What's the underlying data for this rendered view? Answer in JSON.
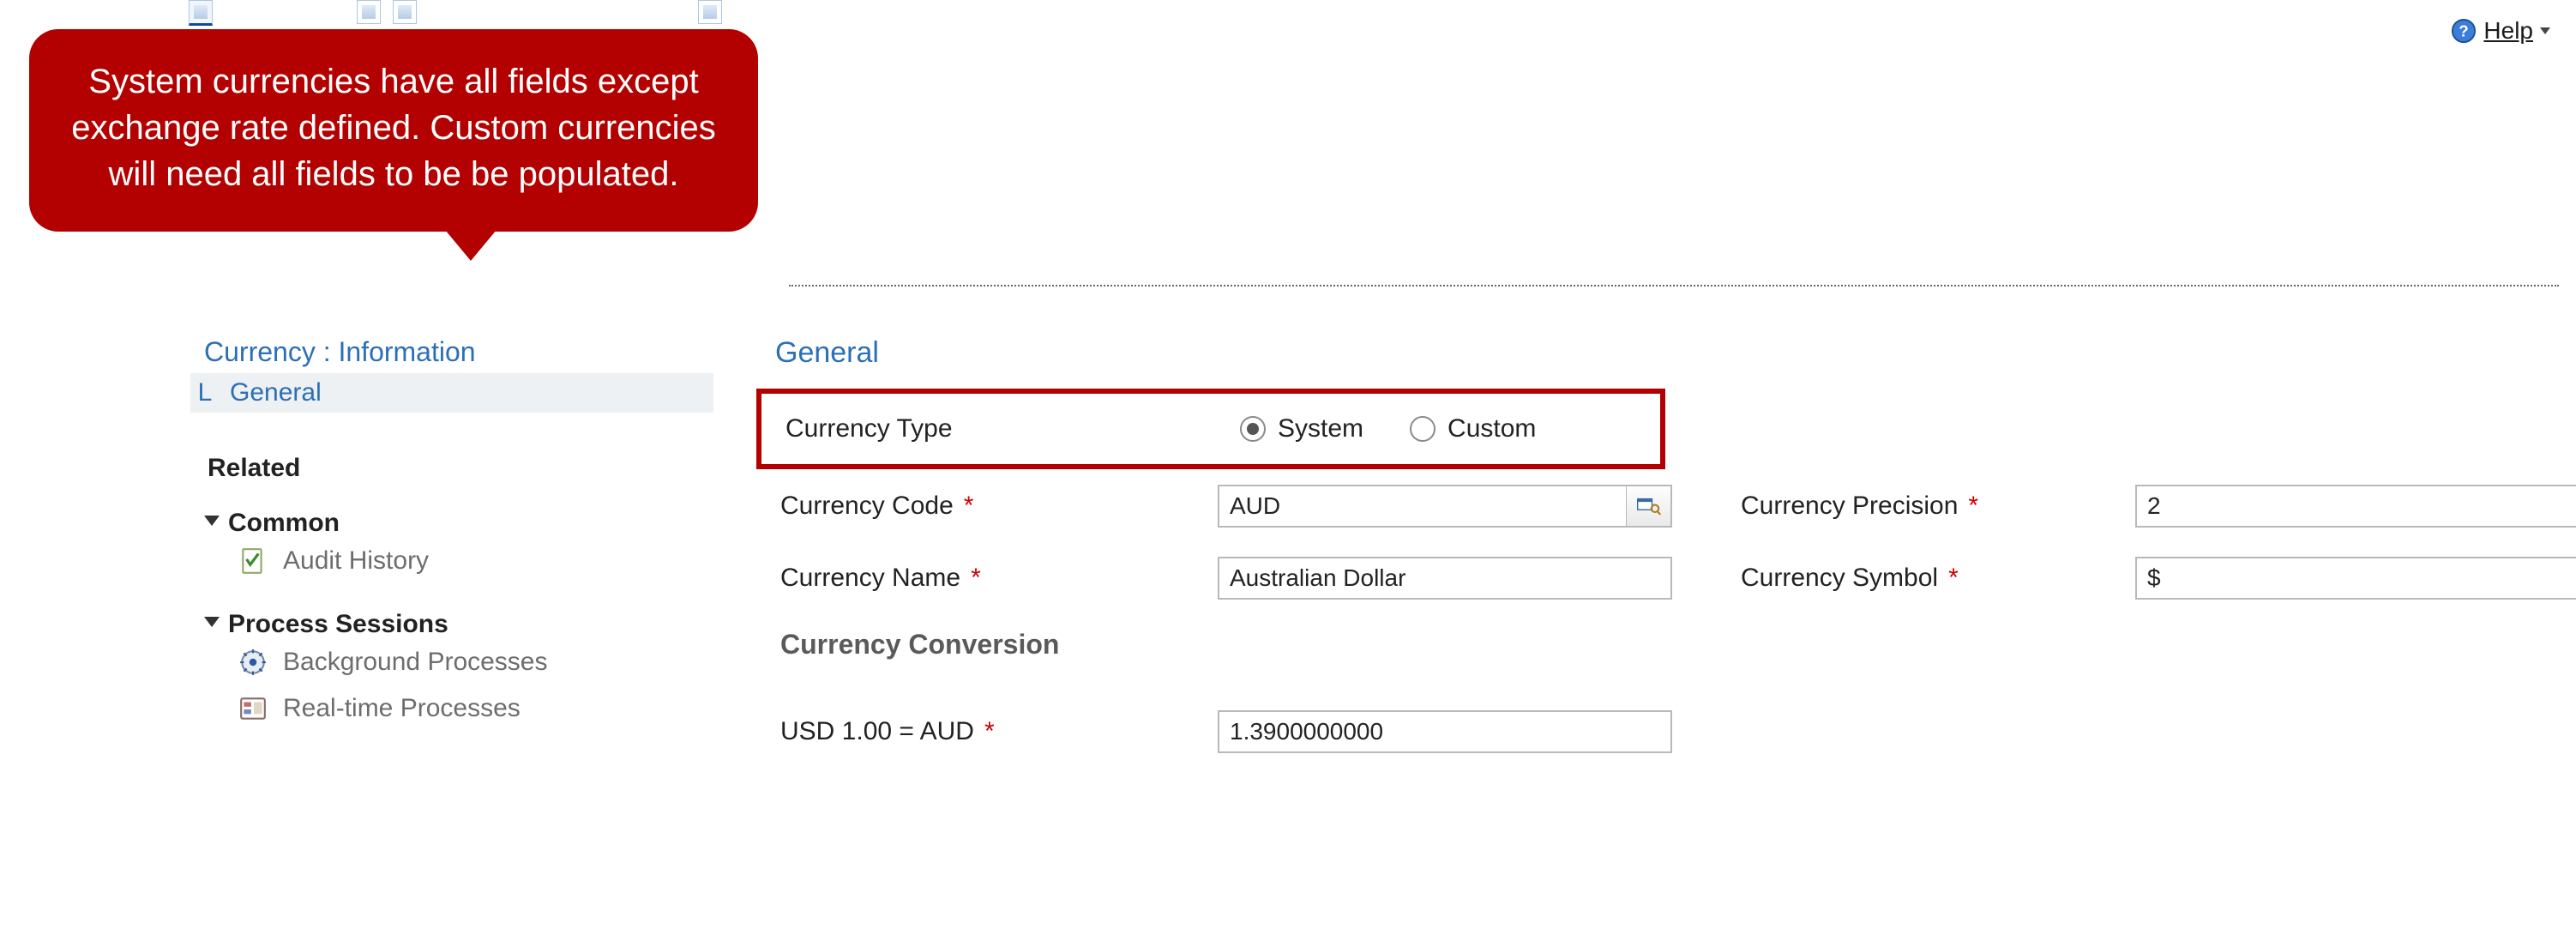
{
  "help": {
    "label": "Help"
  },
  "callout": {
    "text": "System currencies have all fields except exchange rate defined.  Custom currencies will need all fields to be be populated."
  },
  "sideNav": {
    "groupTitle": "Currency : Information",
    "generalLink": "General",
    "relatedHeading": "Related",
    "common": {
      "label": "Common",
      "auditHistory": "Audit History"
    },
    "processSessions": {
      "label": "Process Sessions",
      "background": "Background Processes",
      "realtime": "Real-time Processes"
    }
  },
  "form": {
    "sectionTitle": "General",
    "currencyType": {
      "label": "Currency Type",
      "systemLabel": "System",
      "customLabel": "Custom",
      "selected": "System"
    },
    "currencyCode": {
      "label": "Currency Code",
      "value": "AUD"
    },
    "currencyPrecision": {
      "label": "Currency Precision",
      "value": "2"
    },
    "currencyName": {
      "label": "Currency Name",
      "value": "Australian Dollar"
    },
    "currencySymbol": {
      "label": "Currency Symbol",
      "value": "$"
    },
    "conversionHeading": "Currency Conversion",
    "exchangeRate": {
      "label": "USD 1.00 = AUD",
      "value": "1.3900000000"
    }
  }
}
